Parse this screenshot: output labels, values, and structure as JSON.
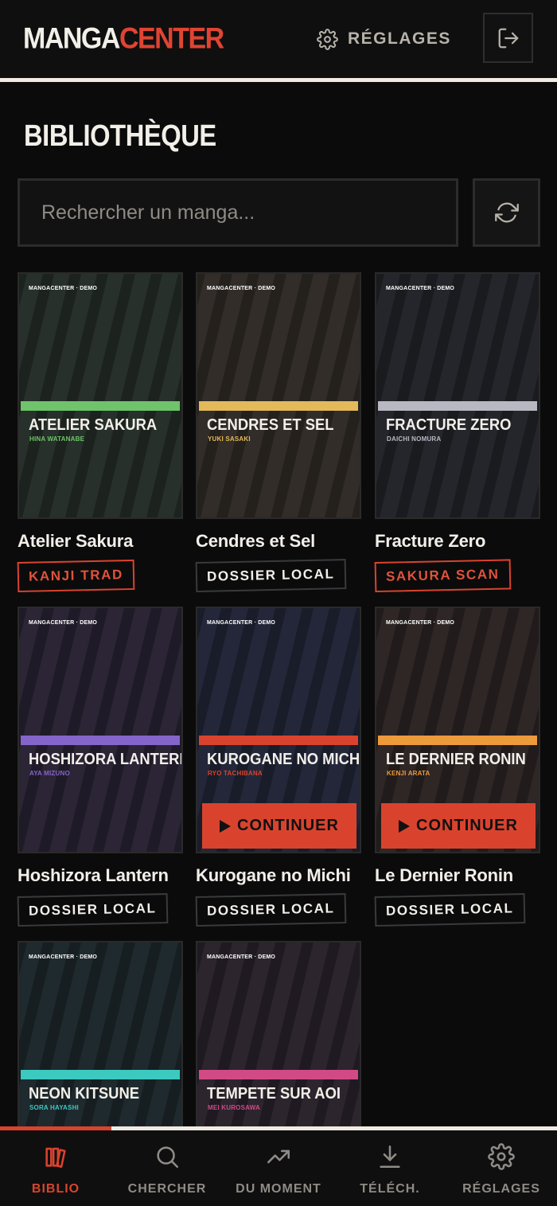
{
  "app": {
    "logo_part1": "MANGA",
    "logo_part2": "CENTER"
  },
  "header": {
    "settings_label": "RÉGLAGES",
    "settings_icon": "gear-icon",
    "logout_icon": "logout-icon"
  },
  "page": {
    "title": "BIBLIOTHÈQUE"
  },
  "search": {
    "placeholder": "Rechercher un manga...",
    "value": ""
  },
  "cover_brand": "MANGACENTER · DEMO",
  "continue_label": "CONTINUER",
  "library": [
    {
      "cover_title": "ATELIER SAKURA",
      "author": "HINA WATANABE",
      "title": "Atelier Sakura",
      "source": "KANJI TRAD",
      "badge_style": "red",
      "accent": "#6fc36a",
      "bg": "#27302a",
      "continue": false
    },
    {
      "cover_title": "CENDRES ET SEL",
      "author": "YUKI SASAKI",
      "title": "Cendres et Sel",
      "source": "DOSSIER LOCAL",
      "badge_style": "dark",
      "accent": "#e3b95a",
      "bg": "#322d28",
      "continue": false
    },
    {
      "cover_title": "FRACTURE ZERO",
      "author": "DAICHI NOMURA",
      "title": "Fracture Zero",
      "source": "SAKURA SCAN",
      "badge_style": "red",
      "accent": "#b9b8c2",
      "bg": "#25262c",
      "continue": false
    },
    {
      "cover_title": "HOSHIZORA LANTERN",
      "author": "AYA MIZUNO",
      "title": "Hoshizora Lantern",
      "source": "DOSSIER LOCAL",
      "badge_style": "dark",
      "accent": "#8565c9",
      "bg": "#2c2536",
      "continue": false
    },
    {
      "cover_title": "KUROGANE NO MICHI",
      "author": "RYO TACHIBANA",
      "title": "Kurogane no Michi",
      "source": "DOSSIER LOCAL",
      "badge_style": "dark",
      "accent": "#d9432e",
      "bg": "#232739",
      "continue": true
    },
    {
      "cover_title": "LE DERNIER RONIN",
      "author": "KENJI ARATA",
      "title": "Le Dernier Ronin",
      "source": "DOSSIER LOCAL",
      "badge_style": "dark",
      "accent": "#ec9a3c",
      "bg": "#2f2626",
      "continue": true
    },
    {
      "cover_title": "NEON KITSUNE",
      "author": "SORA HAYASHI",
      "title": "",
      "source": "",
      "badge_style": "dark",
      "accent": "#3ccac0",
      "bg": "#1f2a2e",
      "continue": false
    },
    {
      "cover_title": "TEMPETE SUR AOI",
      "author": "MEI KUROSAWA",
      "title": "",
      "source": "",
      "badge_style": "dark",
      "accent": "#d14a86",
      "bg": "#2c252e",
      "continue": false
    }
  ],
  "nav": [
    {
      "label": "BIBLIO",
      "icon": "library-icon",
      "active": true
    },
    {
      "label": "CHERCHER",
      "icon": "search-icon",
      "active": false
    },
    {
      "label": "DU MOMENT",
      "icon": "trending-icon",
      "active": false
    },
    {
      "label": "TÉLÉCH.",
      "icon": "download-icon",
      "active": false
    },
    {
      "label": "RÉGLAGES",
      "icon": "gear-icon",
      "active": false
    }
  ]
}
